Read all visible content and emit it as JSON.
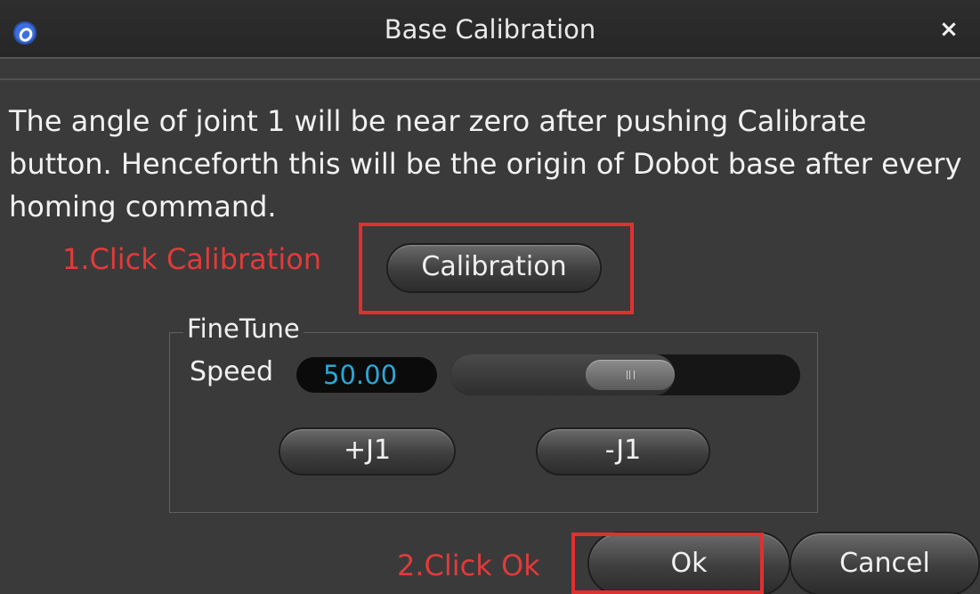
{
  "window": {
    "title": "Base Calibration",
    "close_glyph": "×",
    "app_icon": "dobot-logo-icon",
    "close_icon": "close-icon"
  },
  "description": "The angle of joint 1 will be near zero after pushing Calibrate button. Henceforth this will be the origin of Dobot base after every homing command.",
  "annotations": {
    "step1": "1.Click Calibration",
    "step2": "2.Click Ok",
    "color": "#e23a3a"
  },
  "buttons": {
    "calibration": "Calibration",
    "j1_plus": "+J1",
    "j1_minus": "-J1",
    "ok": "Ok",
    "cancel": "Cancel"
  },
  "finetune": {
    "group_label": "FineTune",
    "speed_label": "Speed",
    "speed_value": "50.00",
    "slider_fraction": 0.64
  },
  "colors": {
    "background": "#3a3a3a",
    "speed_value": "#2aa7d6",
    "highlight_border": "#e03030"
  }
}
